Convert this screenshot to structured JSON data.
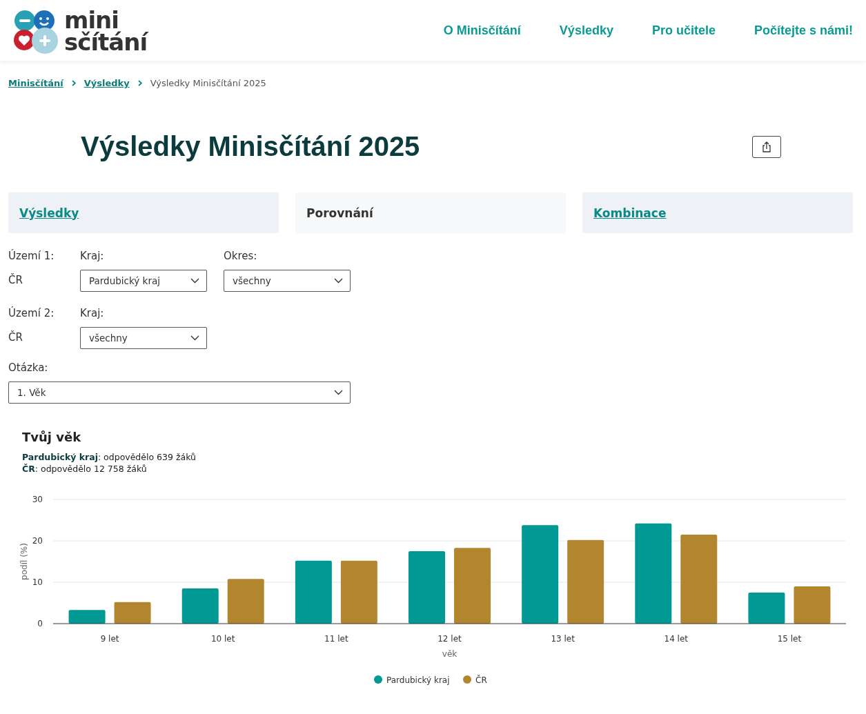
{
  "logo": {
    "line_1": "mini",
    "line_2": "sčítání"
  },
  "nav": [
    "O Minisčítání",
    "Výsledky",
    "Pro učitele",
    "Počítejte s námi!"
  ],
  "breadcrumb": [
    {
      "label": "Minisčítání",
      "link": true
    },
    {
      "label": "Výsledky",
      "link": true
    },
    {
      "label": "Výsledky Minisčítání 2025",
      "link": false
    }
  ],
  "title": "Výsledky Minisčítání 2025",
  "tabs": [
    {
      "label": "Výsledky",
      "selected": false
    },
    {
      "label": "Porovnání",
      "selected": true
    },
    {
      "label": "Kombinace",
      "selected": false
    }
  ],
  "filters": [
    {
      "label": "Území 1:",
      "value": "ČR",
      "selects": [
        {
          "label": "Kraj:",
          "value": "Pardubický kraj"
        },
        {
          "label": "Okres:",
          "value": "všechny"
        }
      ]
    },
    {
      "label": "Území 2:",
      "value": "ČR",
      "selects": [
        {
          "label": "Kraj:",
          "value": "všechny"
        }
      ]
    }
  ],
  "question": {
    "label": "Otázka:",
    "value": "1. Věk"
  },
  "result": {
    "title": "Tvůj věk",
    "notes": [
      "**Pardubický kraj**: odpovědělo 639 žáků",
      "**ČR**: odpovědělo 12 758 žáků"
    ],
    "chart_data": {
      "type": "bar",
      "xlabel": "věk",
      "ylabel": "podíl (%)",
      "categories": [
        "9 let",
        "10 let",
        "11 let",
        "12 let",
        "13 let",
        "14 let",
        "15 let"
      ],
      "series": [
        {
          "name": "Pardubický kraj",
          "color": "#009994",
          "values": [
            3.3,
            8.5,
            15.2,
            17.5,
            23.8,
            24.2,
            7.5
          ]
        },
        {
          "name": "ČR",
          "color": "#b2862f",
          "values": [
            5.2,
            10.8,
            15.2,
            18.3,
            20.2,
            21.5,
            9.0
          ]
        }
      ],
      "ylim": [
        0,
        30
      ],
      "yticks": [
        0,
        10,
        20,
        30
      ],
      "legend": "bottom"
    }
  }
}
